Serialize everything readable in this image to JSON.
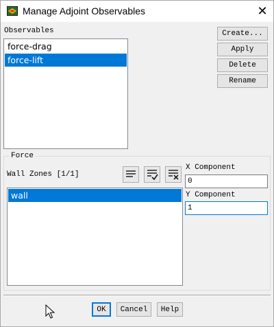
{
  "window": {
    "title": "Manage Adjoint Observables",
    "close_glyph": "✕"
  },
  "observables": {
    "label": "Observables",
    "items": [
      {
        "label": "force-drag",
        "selected": false
      },
      {
        "label": "force-lift",
        "selected": true
      }
    ]
  },
  "actions": {
    "create_label": "Create...",
    "apply_label": "Apply",
    "delete_label": "Delete",
    "rename_label": "Rename"
  },
  "force": {
    "group_label": "Force",
    "wall_zones_label": "Wall Zones [1/1]",
    "wall_zones": [
      {
        "label": "wall",
        "selected": true
      }
    ],
    "x_component_label": "X Component",
    "x_component_value": "0",
    "y_component_label": "Y Component",
    "y_component_value": "1",
    "icons": [
      "select-all-icon",
      "deselect-all-icon",
      "clear-selection-icon"
    ]
  },
  "footer": {
    "ok_label": "OK",
    "cancel_label": "Cancel",
    "help_label": "Help"
  },
  "colors": {
    "selection": "#0078d7",
    "dialog_bg": "#f0f0f0"
  }
}
